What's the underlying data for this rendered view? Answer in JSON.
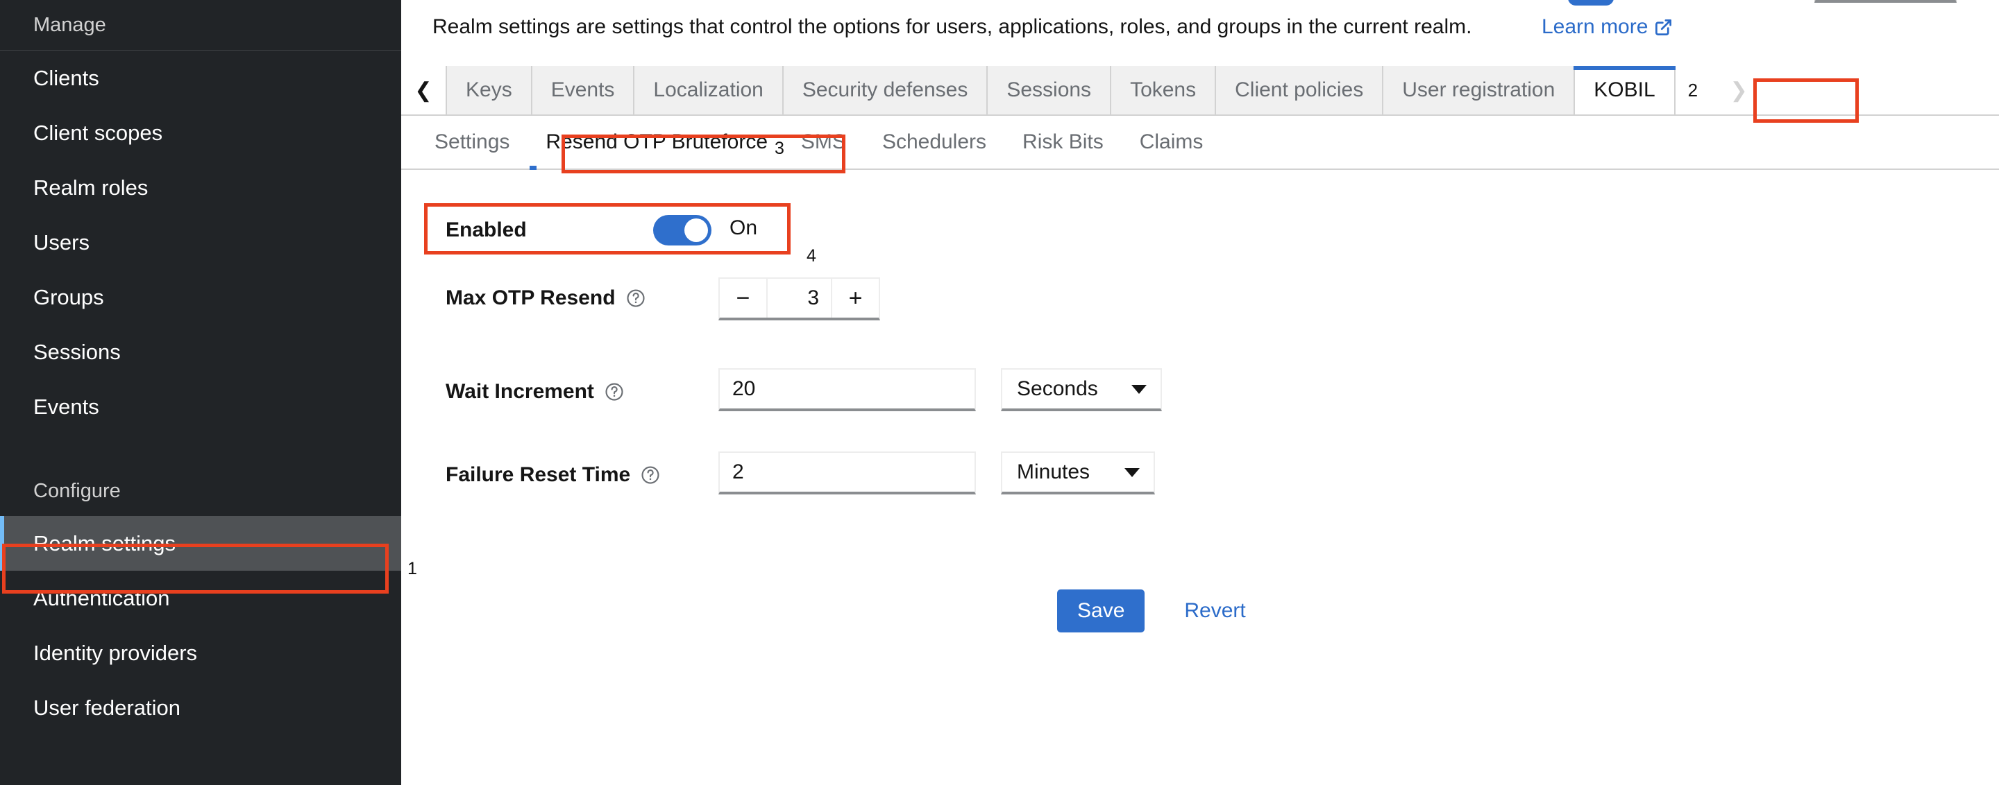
{
  "sidebar": {
    "sections": [
      {
        "label": "Manage",
        "items": [
          {
            "label": "Clients",
            "name": "clients",
            "current": false
          },
          {
            "label": "Client scopes",
            "name": "client-scopes",
            "current": false
          },
          {
            "label": "Realm roles",
            "name": "realm-roles",
            "current": false
          },
          {
            "label": "Users",
            "name": "users",
            "current": false
          },
          {
            "label": "Groups",
            "name": "groups",
            "current": false
          },
          {
            "label": "Sessions",
            "name": "sessions",
            "current": false
          },
          {
            "label": "Events",
            "name": "events",
            "current": false
          }
        ]
      },
      {
        "label": "Configure",
        "items": [
          {
            "label": "Realm settings",
            "name": "realm-settings",
            "current": true
          },
          {
            "label": "Authentication",
            "name": "authentication",
            "current": false
          },
          {
            "label": "Identity providers",
            "name": "identity-providers",
            "current": false
          },
          {
            "label": "User federation",
            "name": "user-federation",
            "current": false
          }
        ]
      }
    ]
  },
  "header": {
    "description": "Realm settings are settings that control the options for users, applications, roles, and groups in the current realm.",
    "learn_more_label": "Learn more",
    "learn_more_icon": "external-link-icon"
  },
  "tabs": {
    "scroll_left_icon": "chevron-left-icon",
    "scroll_right_icon": "chevron-right-icon",
    "items": [
      {
        "label": "Keys",
        "name": "keys",
        "active": false
      },
      {
        "label": "Events",
        "name": "events",
        "active": false
      },
      {
        "label": "Localization",
        "name": "localization",
        "active": false
      },
      {
        "label": "Security defenses",
        "name": "security-defenses",
        "active": false
      },
      {
        "label": "Sessions",
        "name": "sessions",
        "active": false
      },
      {
        "label": "Tokens",
        "name": "tokens",
        "active": false
      },
      {
        "label": "Client policies",
        "name": "client-policies",
        "active": false
      },
      {
        "label": "User registration",
        "name": "user-registration",
        "active": false
      },
      {
        "label": "KOBIL",
        "name": "kobil",
        "active": true
      }
    ],
    "annotation_number": "2"
  },
  "subtabs": {
    "items": [
      {
        "label": "Settings",
        "name": "settings",
        "active": false
      },
      {
        "label": "Resend OTP Bruteforce",
        "name": "resend-otp-bruteforce",
        "active": true
      },
      {
        "label": "SMS",
        "name": "sms",
        "active": false
      },
      {
        "label": "Schedulers",
        "name": "schedulers",
        "active": false
      },
      {
        "label": "Risk Bits",
        "name": "risk-bits",
        "active": false
      },
      {
        "label": "Claims",
        "name": "claims",
        "active": false
      }
    ],
    "annotation_number": "3"
  },
  "form": {
    "enabled": {
      "label": "Enabled",
      "state_text": "On",
      "toggle_on": true,
      "annotation_number": "4"
    },
    "max_otp_resend": {
      "label": "Max OTP Resend",
      "help_icon": "question-circle-icon",
      "value": "3",
      "decrement_label": "−",
      "increment_label": "+"
    },
    "wait_increment": {
      "label": "Wait Increment",
      "help_icon": "question-circle-icon",
      "value": "20",
      "unit": "Seconds"
    },
    "failure_reset_time": {
      "label": "Failure Reset Time",
      "help_icon": "question-circle-icon",
      "value": "2",
      "unit": "Minutes"
    },
    "actions": {
      "save_label": "Save",
      "revert_label": "Revert"
    }
  },
  "annotations": {
    "sidebar_number": "1"
  },
  "colors": {
    "sidebar_bg": "#212427",
    "sidebar_current_bg": "#4f5255",
    "accent_blue": "#2f6fcc",
    "link_blue": "#2b6bc9",
    "annotation_red": "#e8401f",
    "tab_inactive_bg": "#f0f0f0",
    "tab_text": "#6a6e73"
  }
}
